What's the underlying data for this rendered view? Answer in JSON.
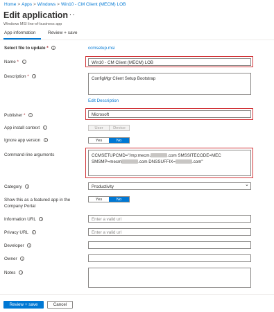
{
  "breadcrumb": {
    "items": [
      "Home",
      "Apps",
      "Windows",
      "Win10 - CM Client (MECM) LOB"
    ],
    "separator": ">"
  },
  "header": {
    "title": "Edit application",
    "more_icon": "ellipsis-icon",
    "more_glyph": "···",
    "subtitle": "Windows MSI line-of-business app"
  },
  "tabs": [
    {
      "label": "App information",
      "active": true
    },
    {
      "label": "Review + save",
      "active": false
    }
  ],
  "form": {
    "select_file": {
      "label": "Select file to update",
      "required": "*",
      "value": "ccmsetup.msi"
    },
    "name": {
      "label": "Name",
      "required": "*",
      "value": "Win10 - CM Client (MECM) LOB"
    },
    "description": {
      "label": "Description",
      "required": "*",
      "value": "ConfigMgr Client Setup Bootstrap",
      "edit_link": "Edit Description"
    },
    "publisher": {
      "label": "Publisher",
      "required": "*",
      "value": "Microsoft"
    },
    "install_context": {
      "label": "App install context",
      "options": [
        "User",
        "Device"
      ]
    },
    "ignore_version": {
      "label": "Ignore app version",
      "options": [
        "Yes",
        "No"
      ],
      "selected": "No"
    },
    "cmdline": {
      "label": "Command-line arguments",
      "line1a": "CCMSETUPCMD=\"/mp:mecm.",
      "line1b": ".com SMSSITECODE=MEC",
      "line2a": "SMSMP=mecm",
      "line2b": ".com DNSSUFFIX=",
      "line2c": ".com\""
    },
    "category": {
      "label": "Category",
      "value": "Productivity",
      "chevron_icon": "chevron-down-icon",
      "chevron_glyph": "⌄"
    },
    "featured": {
      "label_line1": "Show this as a featured app in the",
      "label_line2": "Company Portal",
      "options": [
        "Yes",
        "No"
      ],
      "selected": "No"
    },
    "info_url": {
      "label": "Information URL",
      "placeholder": "Enter a valid url"
    },
    "privacy_url": {
      "label": "Privacy URL",
      "placeholder": "Enter a valid url"
    },
    "developer": {
      "label": "Developer",
      "value": ""
    },
    "owner": {
      "label": "Owner",
      "value": ""
    },
    "notes": {
      "label": "Notes",
      "value": ""
    }
  },
  "footer": {
    "primary": "Review + save",
    "secondary": "Cancel"
  },
  "colors": {
    "accent": "#0078d4",
    "highlight_box": "#d13438",
    "required": "#a4262c"
  },
  "info_glyph": "i"
}
